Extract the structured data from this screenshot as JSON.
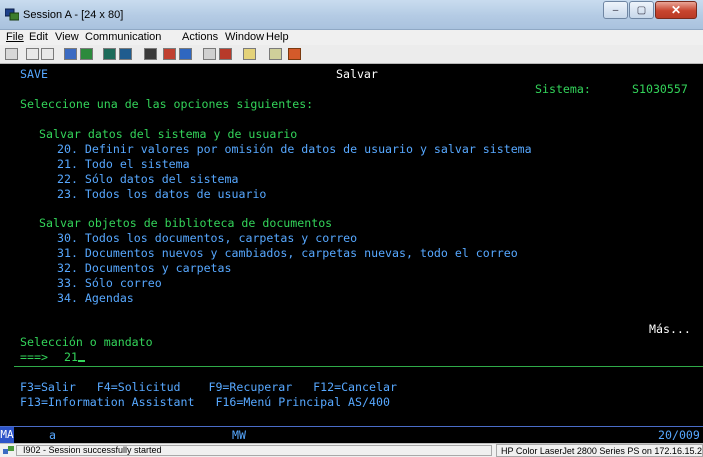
{
  "window": {
    "title": "Session A - [24 x 80]",
    "minimize": "–",
    "maximize": "▢",
    "close": "✕"
  },
  "menu": {
    "file": "File",
    "edit": "Edit",
    "view": "View",
    "communication": "Communication",
    "actions": "Actions",
    "window": "Window",
    "help": "Help"
  },
  "toolbar": {
    "icons": [
      "print-screen-icon",
      "copy-icon",
      "paste-icon",
      "send-icon",
      "receive-icon",
      "display-icon",
      "macro-icon",
      "record-icon",
      "play-icon",
      "stop-icon",
      "keyboard-icon",
      "color-icon",
      "help-icon",
      "palette-icon",
      "customize-icon"
    ]
  },
  "screen": {
    "command": "SAVE",
    "title": "Salvar",
    "system_label": "Sistema:",
    "system_value": "S1030557",
    "instruction": "Seleccione una de las opciones siguientes:",
    "group1": "Salvar datos del sistema y de usuario",
    "options1": [
      "20. Definir valores por omisión de datos de usuario y salvar sistema",
      "21. Todo el sistema",
      "22. Sólo datos del sistema",
      "23. Todos los datos de usuario"
    ],
    "group2": "Salvar objetos de biblioteca de documentos",
    "options2": [
      "30. Todos los documentos, carpetas y correo",
      "31. Documentos nuevos y cambiados, carpetas nuevas, todo el correo",
      "32. Documentos y carpetas",
      "33. Sólo correo",
      "34. Agendas"
    ],
    "more": "Más...",
    "prompt_label": "Selección o mandato",
    "prompt_arrow": "===>",
    "input_value": "21",
    "fkeys_line1": "F3=Salir   F4=Solicitud    F9=Recuperar   F12=Cancelar",
    "fkeys_line2": "F13=Information Assistant   F16=Menú Principal AS/400"
  },
  "oia": {
    "ma": "MA",
    "a": "a",
    "mw": "MW",
    "position": "20/009"
  },
  "status": {
    "message": "I902 - Session successfully started",
    "printer": "HP Color LaserJet 2800 Series PS on 172.16.15.2"
  },
  "colors": {
    "terminal_bg": "#000000",
    "text_green": "#33d45a",
    "text_blue": "#57a8ff",
    "text_white": "#ffffff"
  }
}
